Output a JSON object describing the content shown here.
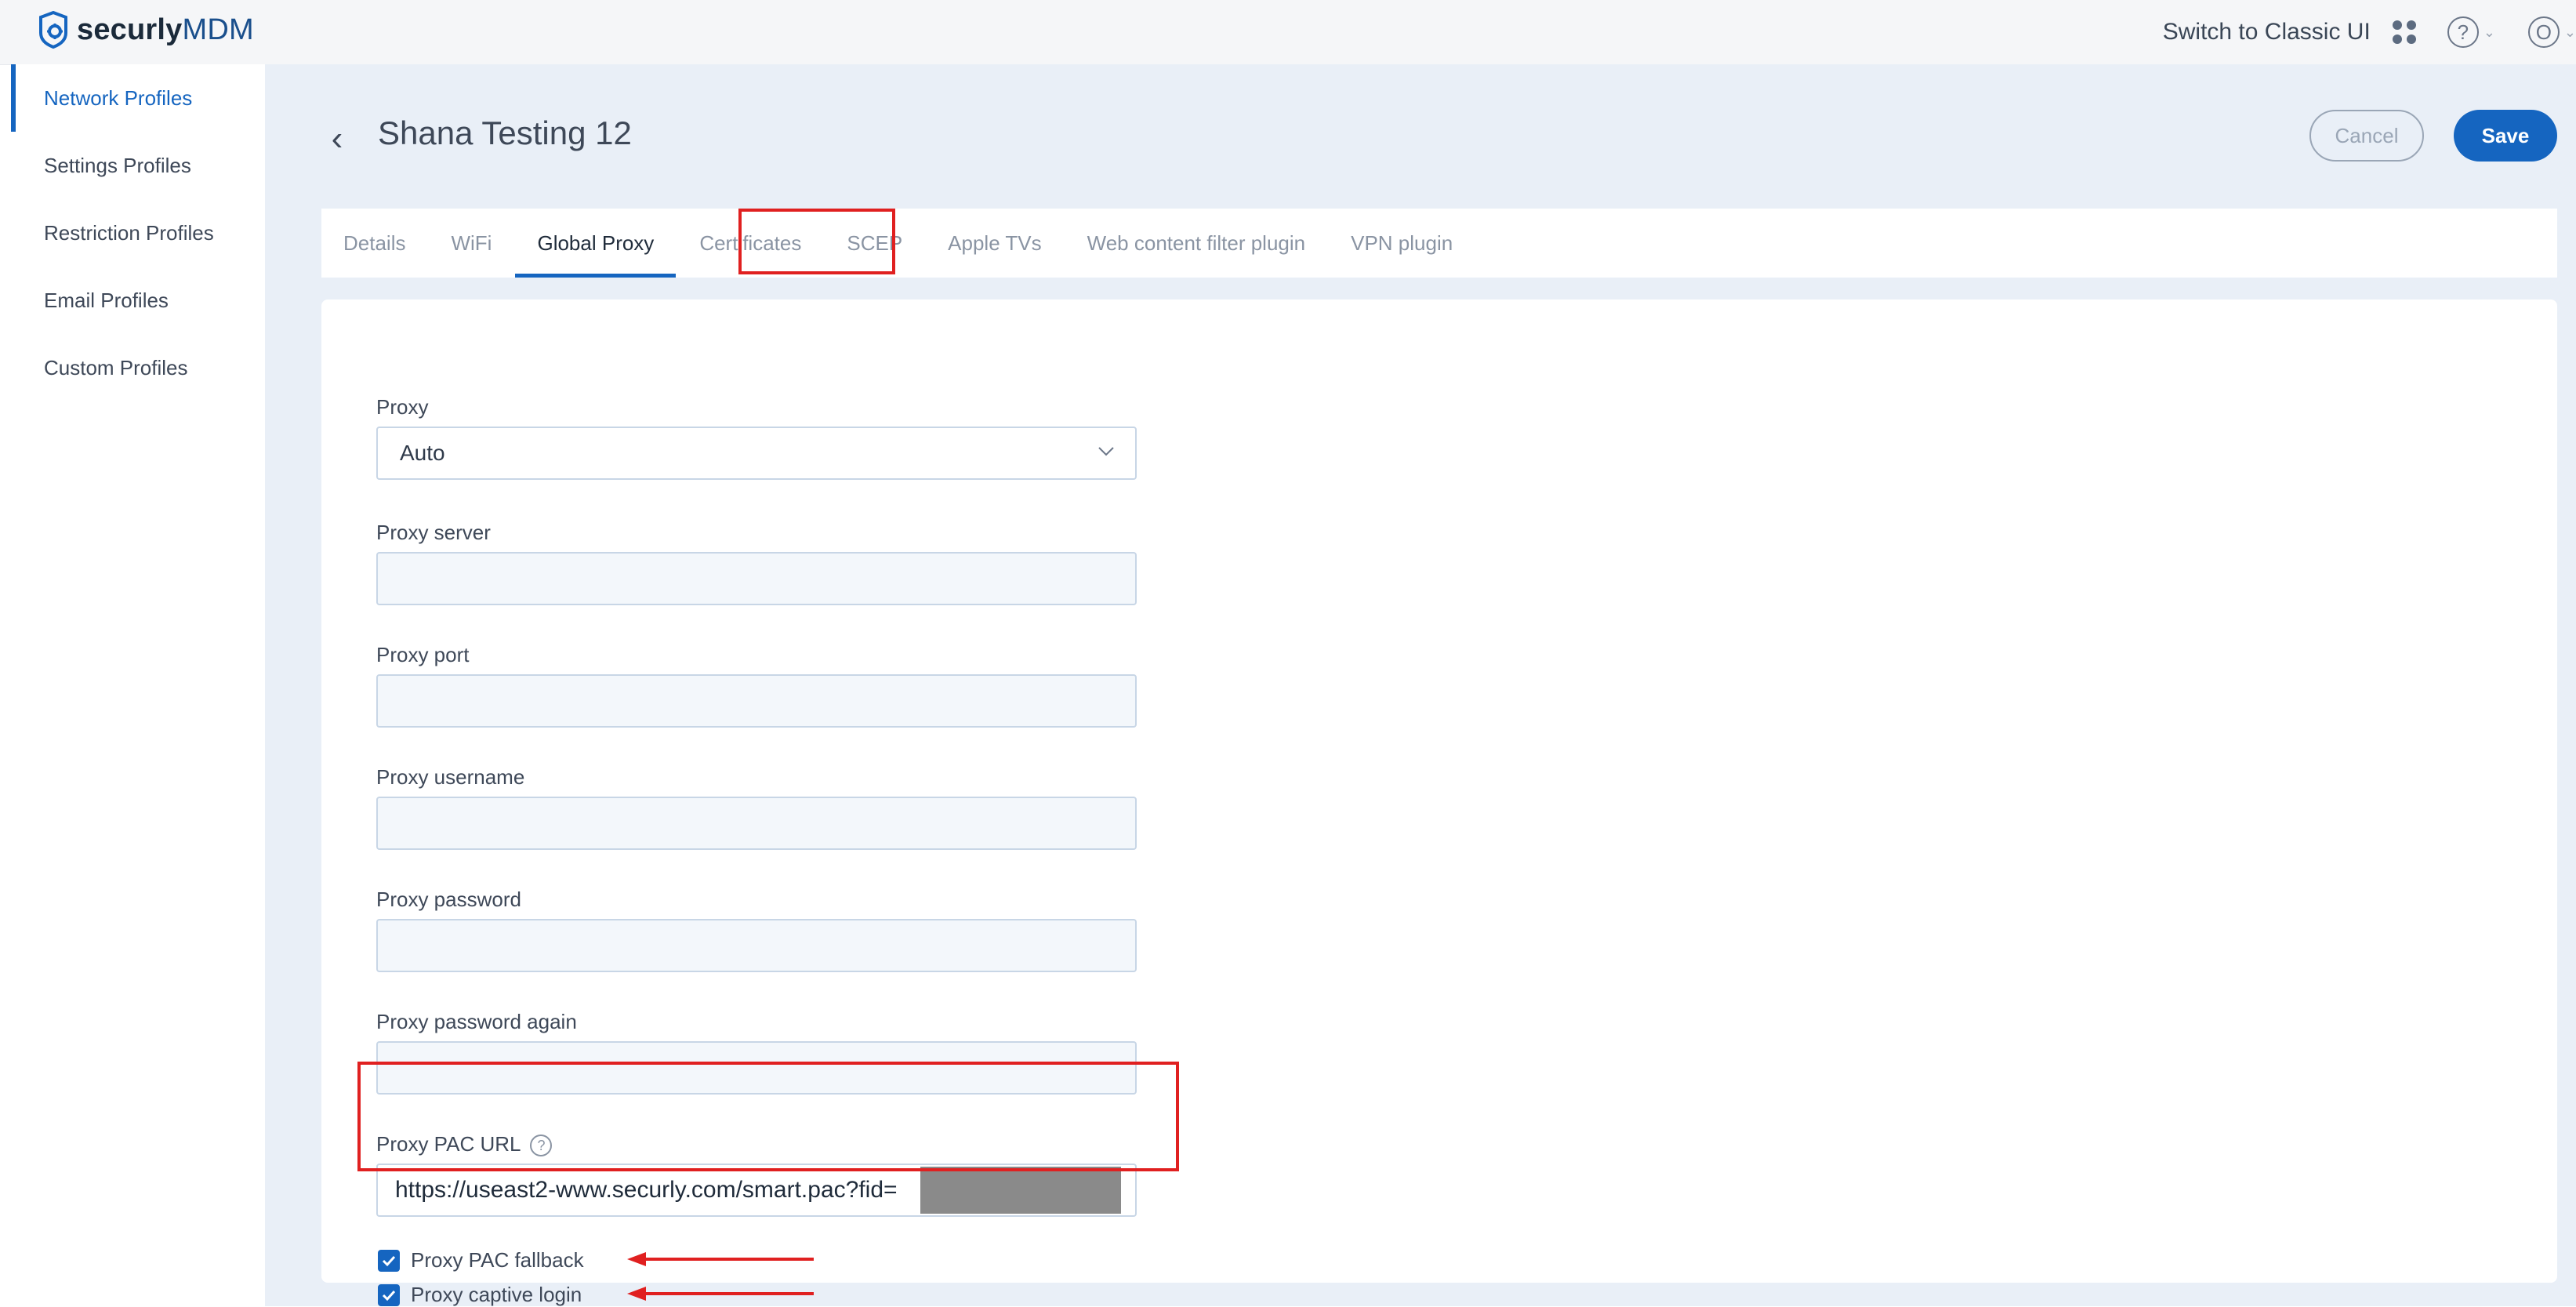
{
  "header": {
    "logo_bold": "securly",
    "logo_light": "MDM",
    "switch_label": "Switch to Classic UI",
    "help_glyph": "?",
    "user_glyph": "O"
  },
  "sidebar": {
    "items": [
      {
        "label": "Network Profiles",
        "active": true
      },
      {
        "label": "Settings Profiles"
      },
      {
        "label": "Restriction Profiles"
      },
      {
        "label": "Email Profiles"
      },
      {
        "label": "Custom Profiles"
      }
    ]
  },
  "page": {
    "title": "Shana Testing 12",
    "cancel_label": "Cancel",
    "save_label": "Save"
  },
  "tabs": [
    {
      "label": "Details"
    },
    {
      "label": "WiFi"
    },
    {
      "label": "Global Proxy",
      "active": true
    },
    {
      "label": "Certificates"
    },
    {
      "label": "SCEP"
    },
    {
      "label": "Apple TVs"
    },
    {
      "label": "Web content filter plugin"
    },
    {
      "label": "VPN plugin"
    }
  ],
  "form": {
    "proxy_label": "Proxy",
    "proxy_value": "Auto",
    "server_label": "Proxy server",
    "server_value": "",
    "port_label": "Proxy port",
    "port_value": "",
    "username_label": "Proxy username",
    "username_value": "",
    "password_label": "Proxy password",
    "password_value": "",
    "password_again_label": "Proxy password again",
    "password_again_value": "",
    "pac_url_label": "Proxy PAC URL",
    "pac_url_value": "https://useast2-www.securly.com/smart.pac?fid=",
    "pac_fallback_label": "Proxy PAC fallback",
    "pac_fallback_checked": true,
    "captive_login_label": "Proxy captive login",
    "captive_login_checked": true
  },
  "colors": {
    "accent": "#1565c0",
    "annotation": "#e02020"
  }
}
